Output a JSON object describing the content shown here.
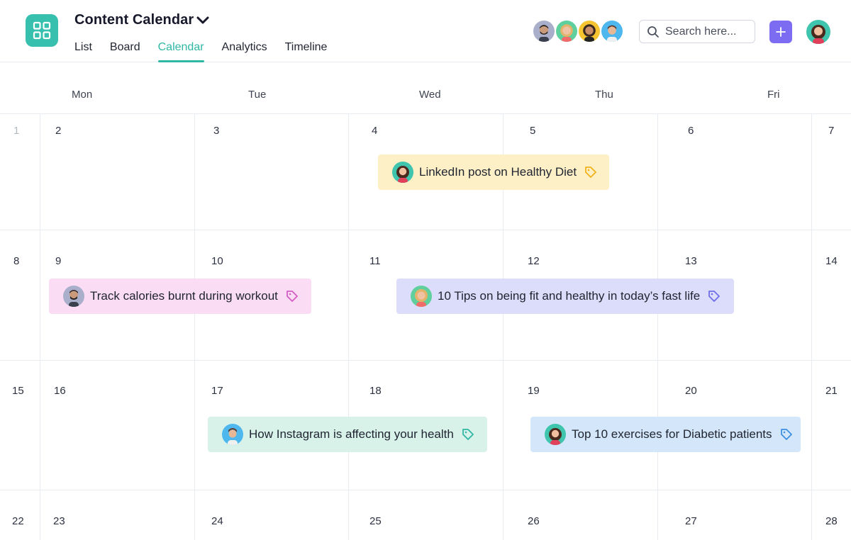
{
  "header": {
    "project_title": "Content Calendar",
    "tabs": [
      {
        "label": "List",
        "active": false
      },
      {
        "label": "Board",
        "active": false
      },
      {
        "label": "Calendar",
        "active": true
      },
      {
        "label": "Analytics",
        "active": false
      },
      {
        "label": "Timeline",
        "active": false
      }
    ],
    "search_placeholder": "Search here...",
    "accent_color": "#2fb7a4",
    "brand_color": "#37c0ad",
    "add_button_color": "#7c6cf2"
  },
  "calendar": {
    "weekdays": [
      "Mon",
      "Tue",
      "Wed",
      "Thu",
      "Fri"
    ],
    "weeks": [
      [
        "1",
        "2",
        "3",
        "4",
        "5",
        "6",
        "7"
      ],
      [
        "8",
        "9",
        "10",
        "11",
        "12",
        "13",
        "14"
      ],
      [
        "15",
        "16",
        "17",
        "18",
        "19",
        "20",
        "21"
      ],
      [
        "22",
        "23",
        "24",
        "25",
        "26",
        "27",
        "28"
      ]
    ],
    "events": [
      {
        "title": "LinkedIn post on Healthy Diet",
        "bg": "#fdefc6",
        "tag_color": "#f2b21a"
      },
      {
        "title": "Track calories burnt during workout",
        "bg": "#fadcf4",
        "tag_color": "#d45dc3"
      },
      {
        "title": "10 Tips on being fit and healthy in today’s fast life",
        "bg": "#dcdcfb",
        "tag_color": "#6e6ee8"
      },
      {
        "title": "How Instagram is affecting your health",
        "bg": "#d8f2ea",
        "tag_color": "#2fb7a4"
      },
      {
        "title": "Top 10 exercises for Diabetic patients",
        "bg": "#d4e7fa",
        "tag_color": "#3d8fe0"
      }
    ]
  }
}
